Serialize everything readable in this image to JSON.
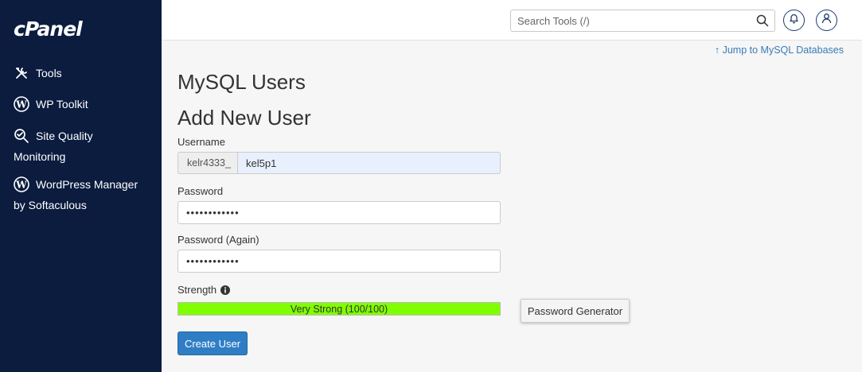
{
  "brand": {
    "logo_text": "cPanel"
  },
  "sidebar": {
    "items": [
      {
        "label_line1": "Tools",
        "label_line2": "",
        "icon": "tools-icon"
      },
      {
        "label_line1": "WP Toolkit",
        "label_line2": "",
        "icon": "wordpress-icon"
      },
      {
        "label_line1": "Site Quality",
        "label_line2": "Monitoring",
        "icon": "site-quality-icon"
      },
      {
        "label_line1": "WordPress Manager",
        "label_line2": "by Softaculous",
        "icon": "wordpress-icon"
      }
    ]
  },
  "topbar": {
    "search_placeholder": "Search Tools (/)",
    "notifications_icon": "bell-icon",
    "user_icon": "user-icon"
  },
  "page": {
    "jump_link": "Jump to MySQL Databases",
    "title": "MySQL Users",
    "section_title": "Add New User"
  },
  "form": {
    "username_label": "Username",
    "username_prefix": "kelr4333_",
    "username_value": "kel5p1",
    "password_label": "Password",
    "password_value": "abcdefghijkl",
    "password_again_label": "Password (Again)",
    "password_again_value": "abcdefghijkl",
    "strength_label": "Strength",
    "strength_text": "Very Strong (100/100)",
    "strength_value": 100,
    "password_generator_label": "Password Generator",
    "create_button_label": "Create User"
  },
  "colors": {
    "sidebar_bg": "#0b1c3f",
    "accent_blue": "#2f7ec5",
    "link_blue": "#3a7ab8",
    "strength_green": "#80ff00"
  }
}
